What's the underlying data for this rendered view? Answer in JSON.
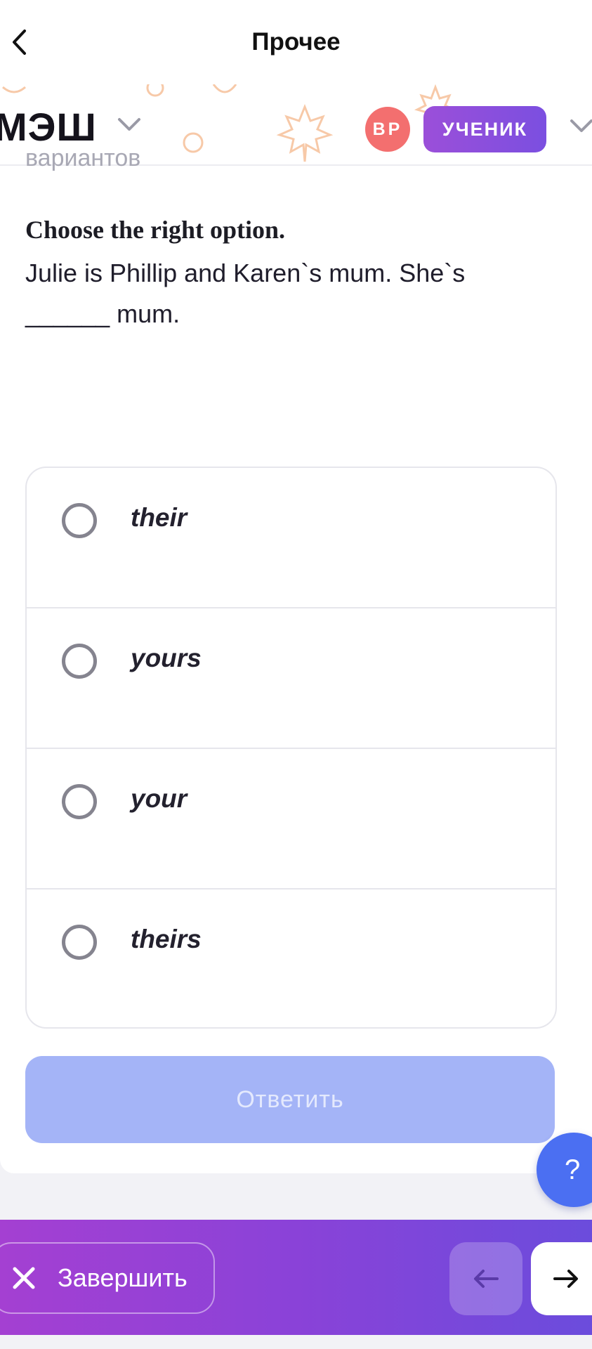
{
  "nav": {
    "title": "Прочее"
  },
  "brand": {
    "logo": "МЭШ",
    "avatar_initials": "ВР",
    "role": "УЧЕНИК"
  },
  "question": {
    "subtitle_partial": "вариантов",
    "instruction": "Choose the right option.",
    "text_line1": "Julie is Phillip and Karen`s mum. She`s",
    "text_line2": "______ mum."
  },
  "options": [
    {
      "label": "their"
    },
    {
      "label": "yours"
    },
    {
      "label": "your"
    },
    {
      "label": "theirs"
    }
  ],
  "submit": {
    "label": "Ответить"
  },
  "help": {
    "label": "?"
  },
  "footer": {
    "finish_label": "Завершить"
  },
  "colors": {
    "accent": "#7b4fe0",
    "submit_disabled": "#a4b4f7",
    "help": "#4b6ff2",
    "avatar": "#f36f6f"
  }
}
